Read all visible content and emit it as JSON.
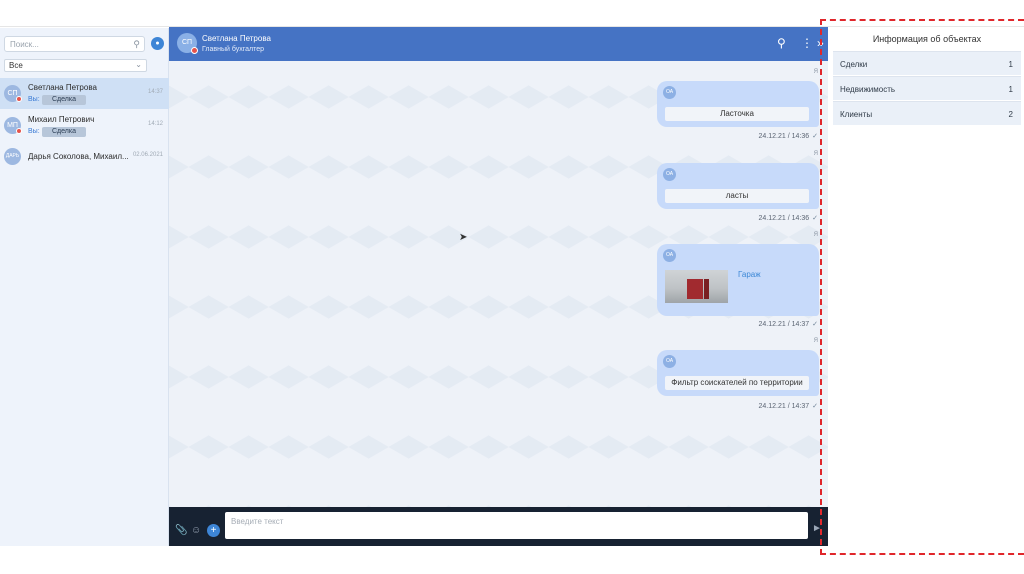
{
  "sidebar": {
    "search_placeholder": "Поиск...",
    "filter_value": "Все",
    "contacts": [
      {
        "initials": "СП",
        "name": "Светлана Петрова",
        "time": "14:37",
        "sub": "Вы:",
        "tag": "Сделка",
        "online_dot": true
      },
      {
        "initials": "МП",
        "name": "Михаил Петрович",
        "time": "14:12",
        "sub": "Вы:",
        "tag": "Сделка",
        "online_dot": true
      },
      {
        "initials": "ДАРЬ",
        "name": "Дарья Соколова, Михаил...",
        "time": "02.06.2021"
      }
    ]
  },
  "chat": {
    "header": {
      "initials": "СП",
      "name": "Светлана Петрова",
      "role": "Главный бухгалтер"
    },
    "messages": [
      {
        "sender": "Я",
        "avatar": "ОА",
        "text": "Ласточка",
        "time": "24.12.21 / 14:36"
      },
      {
        "sender": "Я",
        "avatar": "ОА",
        "text": "ласты",
        "time": "24.12.21 / 14:36"
      },
      {
        "sender": "Я",
        "avatar": "ОА",
        "link": "Гараж",
        "time": "24.12.21 / 14:37"
      },
      {
        "sender": "Я",
        "avatar": "ОА",
        "text": "Фильтр соискателей по территории",
        "time": "24.12.21 / 14:37"
      }
    ],
    "composer_placeholder": "Введите текст"
  },
  "info": {
    "title": "Информация об объектах",
    "rows": [
      {
        "label": "Сделки",
        "value": "1"
      },
      {
        "label": "Недвижимость",
        "value": "1"
      },
      {
        "label": "Клиенты",
        "value": "2"
      }
    ]
  },
  "colors": {
    "header": "#4573c4",
    "bubble": "#c7dafa",
    "composer": "#172232",
    "frame": "#e0262b"
  }
}
